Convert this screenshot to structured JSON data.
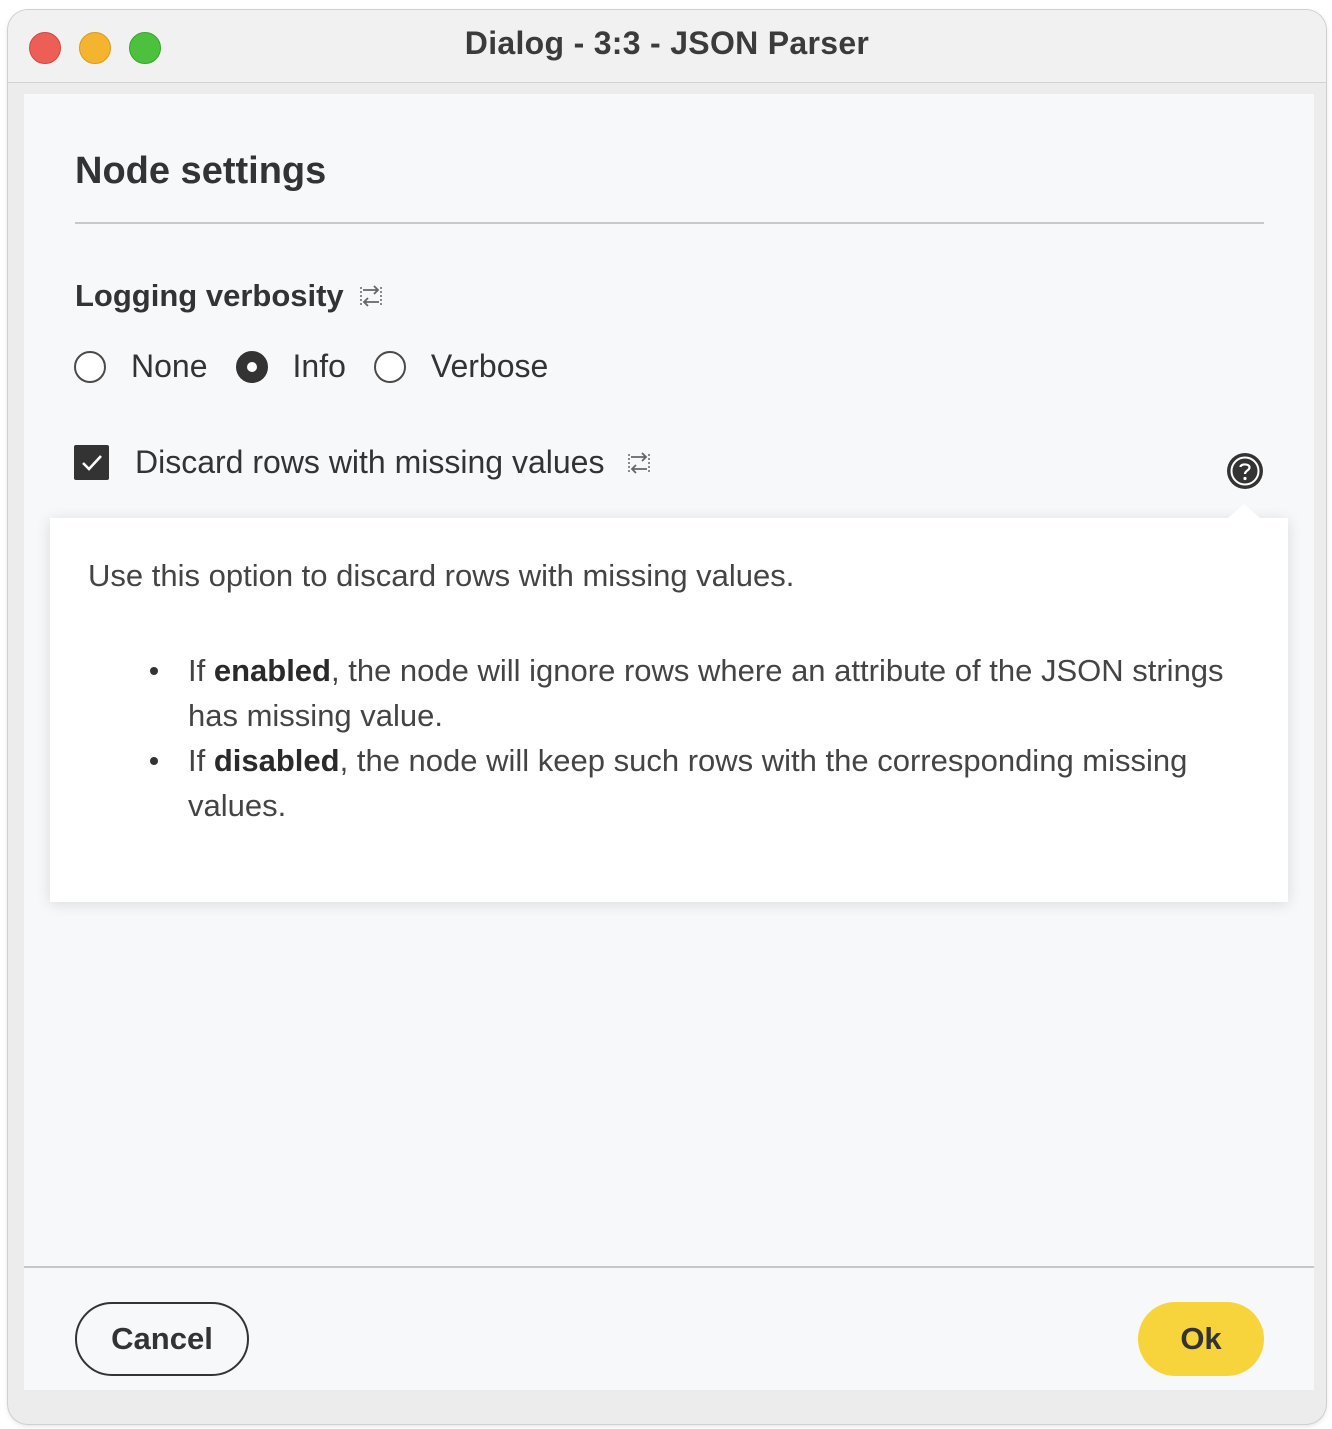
{
  "window": {
    "title": "Dialog - 3:3 - JSON Parser"
  },
  "page": {
    "title": "Node settings"
  },
  "logging": {
    "label": "Logging verbosity",
    "options": [
      "None",
      "Info",
      "Verbose"
    ],
    "selected": "Info"
  },
  "discard": {
    "label": "Discard rows with missing values",
    "checked": true
  },
  "help": {
    "intro": "Use this option to discard rows with missing values.",
    "bullets": [
      {
        "prefix": "If ",
        "bold": "enabled",
        "rest": ", the node will ignore rows where an attribute of the JSON strings has missing value."
      },
      {
        "prefix": "If ",
        "bold": "disabled",
        "rest": ", the node will keep such rows with the corresponding missing values."
      }
    ]
  },
  "footer": {
    "cancel_label": "Cancel",
    "ok_label": "Ok"
  },
  "icons": {
    "flow_variable": "flow-variable-icon",
    "help": "question-mark-icon",
    "check": "checkmark-icon"
  },
  "colors": {
    "ok_button": "#f8d43c",
    "dark": "#333333",
    "content_bg": "#f7f8fa"
  }
}
